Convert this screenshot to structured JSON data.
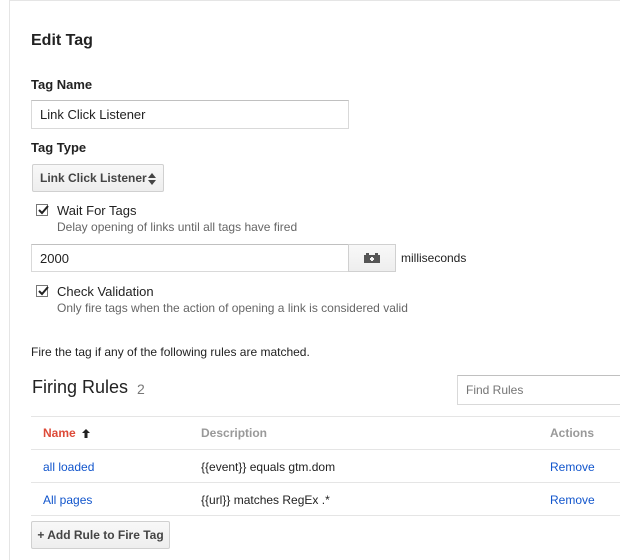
{
  "page": {
    "title": "Edit Tag"
  },
  "tag_name": {
    "label": "Tag Name",
    "value": "Link Click Listener"
  },
  "tag_type": {
    "label": "Tag Type",
    "selected": "Link Click Listener"
  },
  "wait_for_tags": {
    "checked": true,
    "label": "Wait For Tags",
    "description": "Delay opening of links until all tags have fired",
    "timeout_value": "2000",
    "timeout_unit": "milliseconds"
  },
  "check_validation": {
    "checked": true,
    "label": "Check Validation",
    "description": "Only fire tags when the action of opening a link is considered valid"
  },
  "fire_rule_text": "Fire the tag if any of the following rules are matched.",
  "firing_rules": {
    "title": "Firing Rules",
    "count": "2",
    "search_placeholder": "Find Rules",
    "columns": {
      "name": "Name",
      "description": "Description",
      "actions": "Actions"
    },
    "rows": [
      {
        "name": "all loaded",
        "description": "{{event}} equals gtm.dom",
        "action": "Remove"
      },
      {
        "name": "All pages",
        "description": "{{url}} matches RegEx .*",
        "action": "Remove"
      }
    ],
    "add_button": "+ Add Rule to Fire Tag"
  },
  "colors": {
    "link": "#1155cc",
    "sorted_header": "#dd4b39",
    "muted": "#999999"
  }
}
